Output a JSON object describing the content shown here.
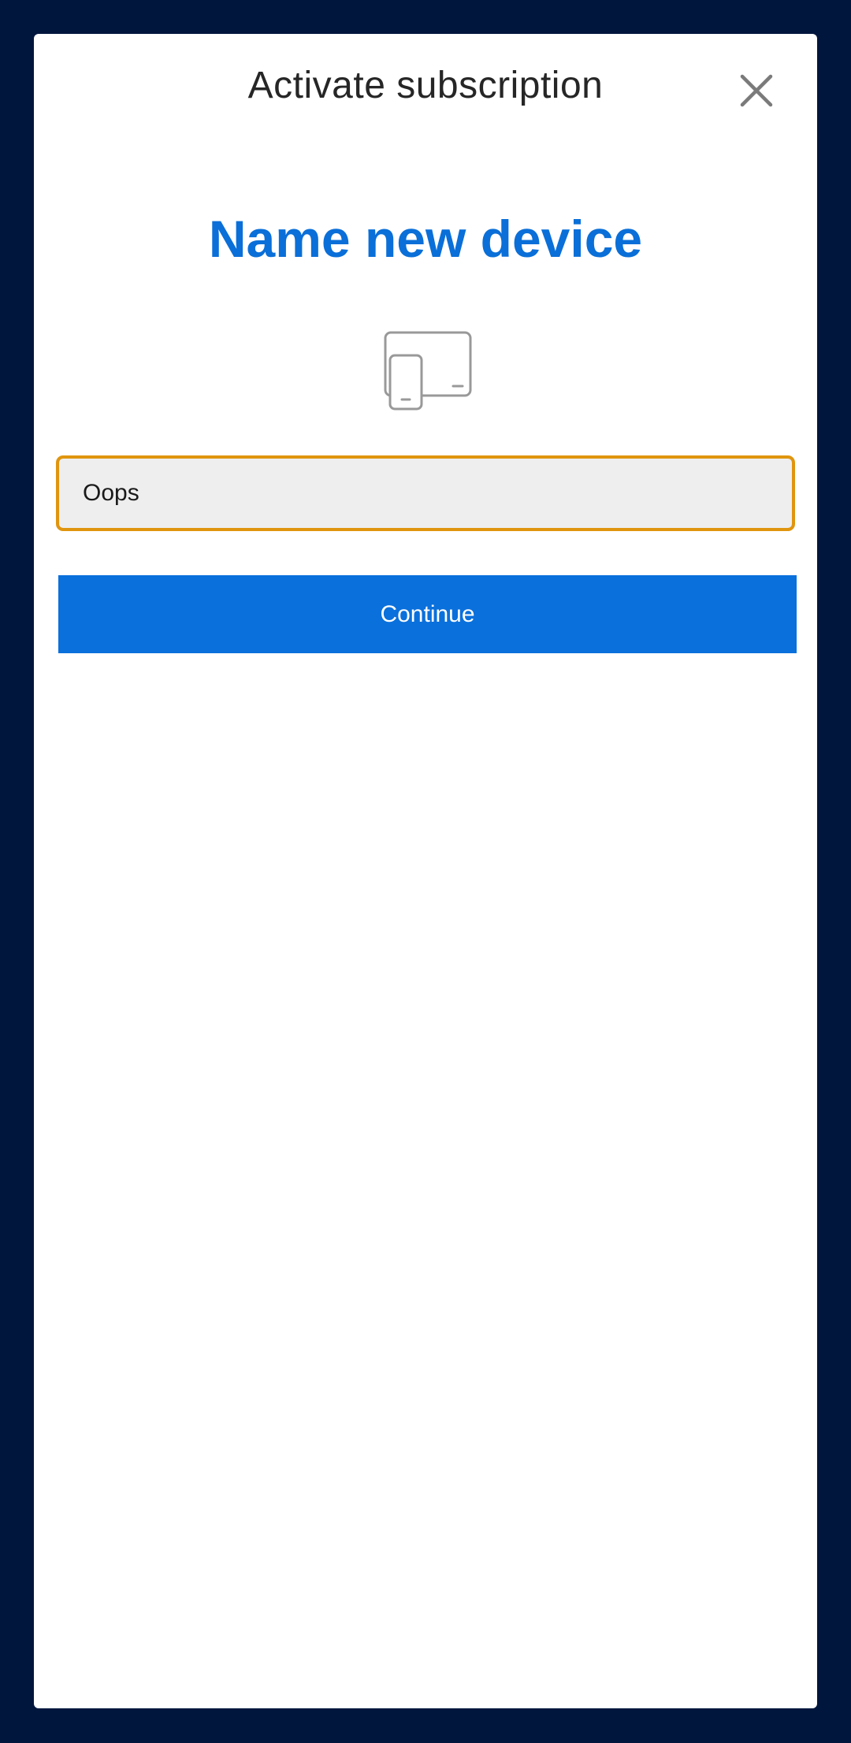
{
  "modal": {
    "title": "Activate subscription",
    "close_icon": "close-icon"
  },
  "content": {
    "heading": "Name new device",
    "device_icon": "devices-icon",
    "device_name_input": {
      "value": "Oops",
      "placeholder": ""
    },
    "continue_label": "Continue"
  },
  "colors": {
    "background": "#00163d",
    "accent": "#0a70dc",
    "focus_border": "#e0950f",
    "input_bg": "#eeeeee",
    "icon_gray": "#999999"
  }
}
